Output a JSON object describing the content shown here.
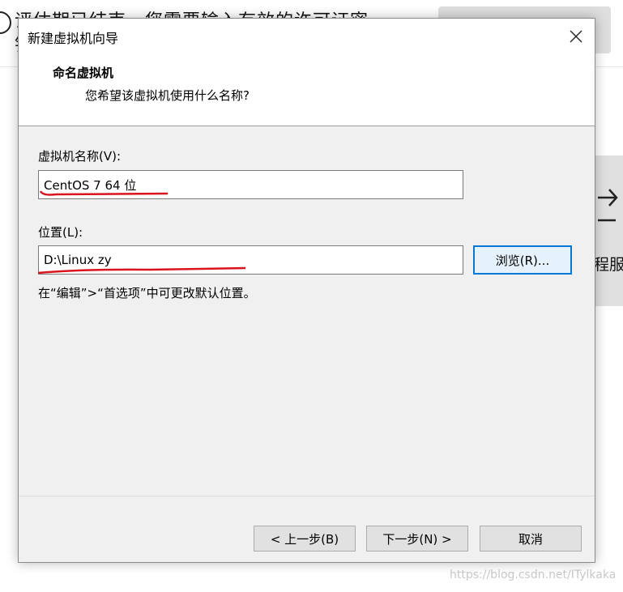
{
  "background_app": {
    "title_line1": "评估期已结束，您需要输入有效的许可证密",
    "title_line2": "钥",
    "side_text": "程服务",
    "watermark": "https://blog.csdn.net/ITylkaka"
  },
  "dialog": {
    "title": "新建虚拟机向导",
    "close_icon": "close-icon",
    "header": {
      "title": "命名虚拟机",
      "subtitle": "您希望该虚拟机使用什么名称?"
    },
    "vm_name": {
      "label": "虚拟机名称(V):",
      "value": "CentOS 7 64 位"
    },
    "location": {
      "label": "位置(L):",
      "value": "D:\\Linux zy"
    },
    "browse_label": "浏览(R)...",
    "hint": "在“编辑”>“首选项”中可更改默认位置。",
    "buttons": {
      "back": "< 上一步(B)",
      "next": "下一步(N) >",
      "cancel": "取消"
    },
    "annotation_color": "#d9141c",
    "accent_color": "#0078d7"
  }
}
